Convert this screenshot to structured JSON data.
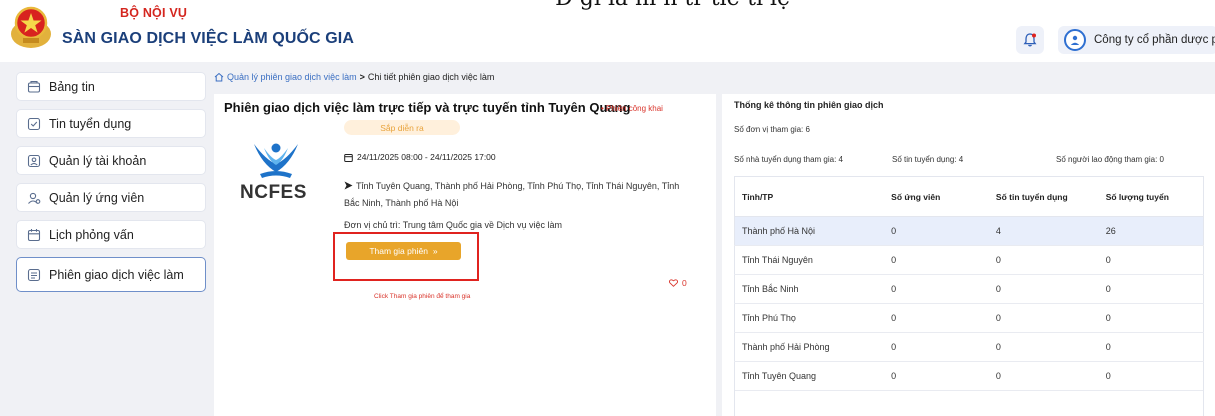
{
  "header": {
    "ministry": "BỘ NỘI VỤ",
    "site_title": "SÀN GIAO DỊCH VIỆC LÀM QUỐC GIA",
    "company_name": "Công ty cổ phần dược phẩ...",
    "accent_color": "#1b3f7a",
    "brand_red": "#d4261f",
    "icons": [
      "emblem-icon",
      "bell-icon",
      "avatar-icon"
    ]
  },
  "top_artifact_text": "Đ gi ia hi n tr tiế ti lệ",
  "sidebar": {
    "items": [
      {
        "label": "Bảng tin",
        "icon": "news-icon"
      },
      {
        "label": "Tin tuyển dụng",
        "icon": "job-post-icon"
      },
      {
        "label": "Quản lý tài khoản",
        "icon": "account-icon"
      },
      {
        "label": "Quản lý ứng viên",
        "icon": "candidate-icon"
      },
      {
        "label": "Lịch phỏng vấn",
        "icon": "calendar-icon"
      },
      {
        "label": "Phiên giao dịch việc làm",
        "icon": "session-icon",
        "active": true
      }
    ]
  },
  "breadcrumb": {
    "parent": "Quản lý phiên giao dịch việc làm",
    "separator": ">",
    "current": "Chi tiết phiên giao dịch việc làm"
  },
  "session": {
    "title": "Phiên giao dịch việc làm trực tiếp và trực tuyến tỉnh Tuyên Quang",
    "public_tag": "• Phiên công khai",
    "status": "Sắp diễn ra",
    "logo_text": "NCFES",
    "datetime": "24/11/2025 08:00 - 24/11/2025 17:00",
    "location": "Tỉnh Tuyên Quang, Thành phố Hải Phòng, Tỉnh Phú Thọ, Tỉnh Thái Nguyên, Tỉnh Bắc Ninh, Thành phố Hà Nội",
    "organizer": "Đơn vị chủ trì: Trung tâm Quốc gia về Dịch vụ việc làm",
    "join_button": "Tham gia phiên",
    "join_chevron": "»",
    "likes": "0",
    "hint": "Click Tham gia phiên để tham gia"
  },
  "stats": {
    "title": "Thống kê thông tin phiên giao dịch",
    "units": "Số đơn vị tham gia: 6",
    "employers": "Số nhà tuyển dụng tham gia: 4",
    "jobs": "Số tin tuyển dụng: 4",
    "workers": "Số người lao động tham gia: 0",
    "table": {
      "headers": [
        "Tỉnh/TP",
        "Số ứng viên",
        "Số tin tuyển dụng",
        "Số lượng tuyển"
      ],
      "rows": [
        [
          "Thành phố Hà Nội",
          "0",
          "4",
          "26"
        ],
        [
          "Tỉnh Thái Nguyên",
          "0",
          "0",
          "0"
        ],
        [
          "Tỉnh Bắc Ninh",
          "0",
          "0",
          "0"
        ],
        [
          "Tỉnh Phú Thọ",
          "0",
          "0",
          "0"
        ],
        [
          "Thành phố Hải Phòng",
          "0",
          "0",
          "0"
        ],
        [
          "Tỉnh Tuyên Quang",
          "0",
          "0",
          "0"
        ]
      ]
    }
  }
}
